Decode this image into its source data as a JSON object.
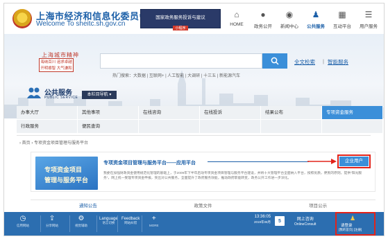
{
  "header": {
    "site_name_cn": "上海市经济和信息化委员会",
    "site_name_en": "Welcome To sheitc.sh.gov.cn",
    "banner_line1": "国家政务服务投诉与建议",
    "banner_line2": "小程序"
  },
  "nav": [
    {
      "label": "HOME",
      "icon": "home-icon"
    },
    {
      "label": "政务公开",
      "icon": "chat-icon"
    },
    {
      "label": "新闻中心",
      "icon": "globe-icon"
    },
    {
      "label": "公共服务",
      "icon": "people-icon",
      "active": true
    },
    {
      "label": "互动平台",
      "icon": "grid-icon"
    },
    {
      "label": "用户服务",
      "icon": "user-icon"
    }
  ],
  "hero": {
    "spirit_title": "上海城市精神",
    "spirit_line1": "海纳百川 追求卓越",
    "spirit_line2": "开明睿智 大气谦和",
    "search_placeholder": "",
    "hotwords": "热门搜索：大数据 | 互联网+ | 人工智能 | 大调研 | 十三五 | 新能源汽车",
    "fulltext_search": "全文检索",
    "smart_service": "智能服务",
    "public_service_cn": "公共服务",
    "public_service_en": "PUBLIC SERVICE",
    "column_nav": "本栏目导航 ▾"
  },
  "menu": {
    "row1": [
      "办事大厅",
      "其他事项",
      "在线咨询",
      "在线投诉",
      "结果公布",
      "专项资金服务"
    ],
    "row2": [
      "行政服务",
      "便民查询"
    ]
  },
  "breadcrumb": "› 首页 › 专项资金项目管理与服务平台",
  "platform": {
    "title": "专项资金项目管理与服务平台——应用平台",
    "image_line1": "专项资金项目",
    "image_line2": "管理与服务平台",
    "description": "我委在加强财政资金使用规范化管理的基础上，于2009年下半年启动专项资金项目管理与服务平台建设，并将十大管理平台全面纳入平台，按照优质，便民的原则，提供“阳光服务”，网上统一受理专项资金申报，突出对公共服务，全面提升了政府服务效能，推动政府职能转变，政务公开工作进一步深化。",
    "enterprise_user": "企业用户"
  },
  "tabs": [
    {
      "label": "通知公告",
      "active": true
    },
    {
      "label": "政策文件",
      "active": false
    },
    {
      "label": "项目公示",
      "active": false
    }
  ],
  "toolbar": {
    "items": [
      {
        "icon": "clock-icon",
        "t1": "",
        "t2": "信用网站"
      },
      {
        "icon": "share-icon",
        "t1": "",
        "t2": "分享网站"
      },
      {
        "icon": "gear-icon",
        "t1": "",
        "t2": "视觉辅助"
      },
      {
        "icon": "",
        "t1": "Language",
        "t2": "语言切换"
      },
      {
        "icon": "",
        "t1": "Feedback",
        "t2": "网站纠错"
      },
      {
        "icon": "plus-icon",
        "t1": "",
        "t2": "MORE"
      }
    ],
    "time": "13:36:05",
    "date": "2019年06月",
    "cal_day": "5",
    "online": "网上咨询",
    "online_en": "OnlineConsult",
    "login_title": "请登录",
    "login_links": "[我的首页]  [注册]"
  }
}
